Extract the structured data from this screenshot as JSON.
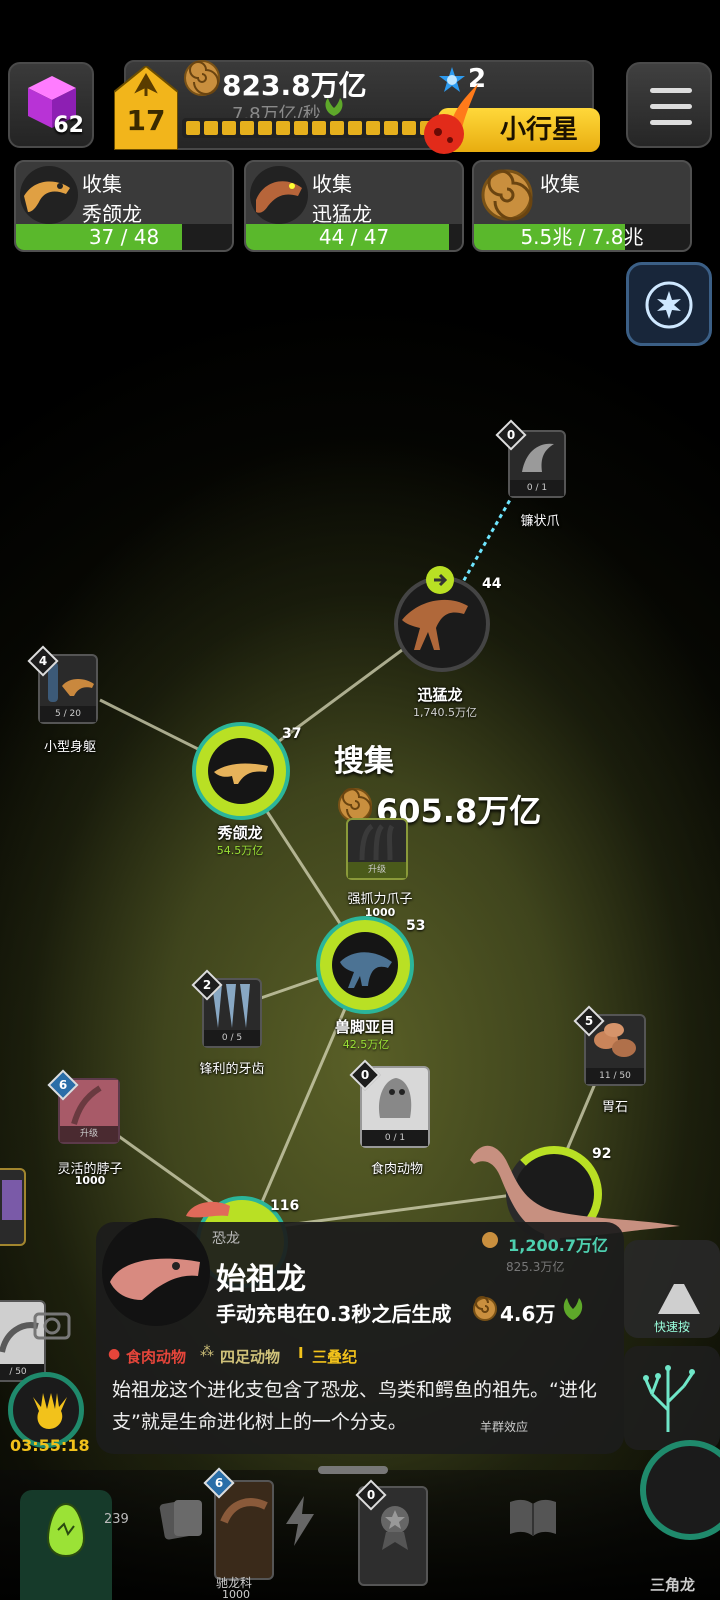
{
  "header": {
    "gem_count": "62",
    "level": "17",
    "fossil_total": "823.8万亿",
    "fossil_rate": "7.8万亿/秒",
    "xp_segments": 16,
    "star_count": "2",
    "asteroid_label": "小行星"
  },
  "collect_cards": [
    {
      "title": "收集",
      "name": "秀颌龙",
      "progress": "37 / 48",
      "fill": 0.77
    },
    {
      "title": "收集",
      "name": "迅猛龙",
      "progress": "44 / 47",
      "fill": 0.94
    },
    {
      "title": "收集",
      "name": "",
      "progress": "5.5兆 / 7.8兆",
      "fill": 0.7
    }
  ],
  "tree": {
    "collect_popup": {
      "label": "搜集",
      "amount": "605.8万亿"
    },
    "velociraptor": {
      "name": "迅猛龙",
      "cost": "1,740.5万亿",
      "count": "44"
    },
    "compsognathus": {
      "name": "秀颌龙",
      "cost": "54.5万亿",
      "count": "37"
    },
    "theropoda": {
      "name": "兽脚亚目",
      "cost": "42.5万亿",
      "count": "53"
    },
    "dinosauria": {
      "name": "恐龙",
      "count": "116"
    },
    "sauropod": {
      "count": "92",
      "cost": "1,200.7万亿",
      "sub": "825.3万亿"
    },
    "sickle_claw": {
      "name": "镰状爪",
      "level": "0",
      "progress": "0 / 1"
    },
    "small_body": {
      "name": "小型身躯",
      "level": "4",
      "progress": "5 / 20"
    },
    "strong_claws": {
      "name": "强抓力爪子",
      "cap": "升级",
      "cost": "1000"
    },
    "sharp_teeth": {
      "name": "锋利的牙齿",
      "level": "2",
      "progress": "0 / 5"
    },
    "carnivore": {
      "name": "食肉动物",
      "level": "0",
      "progress": "0 / 1"
    },
    "gizzard": {
      "name": "胃石",
      "level": "5",
      "progress": "11 / 50"
    },
    "flexible_neck": {
      "name": "灵活的脖子",
      "level": "6",
      "cap": "升级",
      "cost": "1000"
    },
    "left_card": {
      "progress": "/ 50"
    }
  },
  "timer": "03:55:18",
  "info_panel": {
    "group": "恐龙",
    "name": "始祖龙",
    "generate_text": "手动充电在0.3秒之后生成",
    "generate_amount": "4.6万",
    "cost": "1,200.7万亿",
    "cost_sub": "825.3万亿",
    "tags": [
      "食肉动物",
      "四足动物",
      "三叠纪"
    ],
    "description": "始祖龙这个进化支包含了恐龙、鸟类和鳄鱼的祖先。“进化支”就是生命进化树上的一个分支。"
  },
  "bottom_nav": {
    "left_count": "239",
    "card_level": "6",
    "card_name": "驰龙科",
    "card_count": "1000",
    "diamond_level": "0",
    "right_label": "三角龙",
    "side_label": "快速按",
    "side_label2": "羊群效应"
  },
  "colors": {
    "accent_green": "#9be236",
    "gold": "#e6b01d",
    "bar_green": "#5ab82c",
    "teal": "#4ed0b0"
  }
}
